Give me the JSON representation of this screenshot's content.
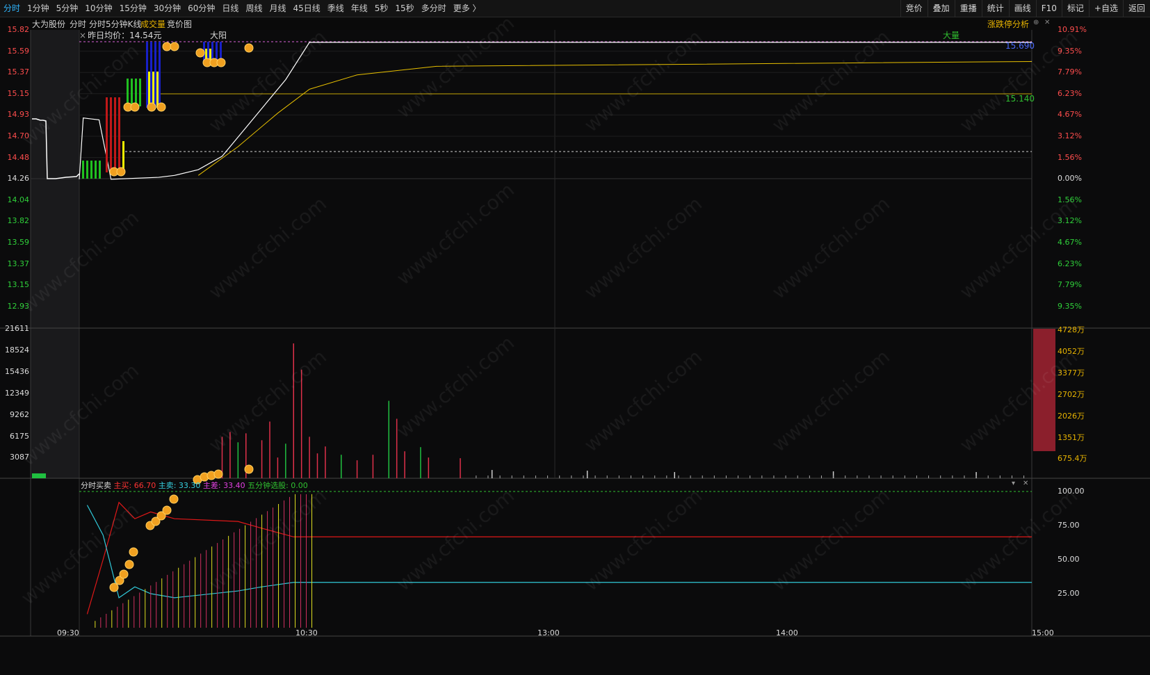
{
  "periods": [
    "分时",
    "1分钟",
    "5分钟",
    "10分钟",
    "15分钟",
    "30分钟",
    "60分钟",
    "日线",
    "周线",
    "月线",
    "45日线",
    "季线",
    "年线",
    "5秒",
    "15秒",
    "多分时",
    "更多 〉"
  ],
  "toolbar_right": [
    "竞价",
    "叠加",
    "重播",
    "统计",
    "画线",
    "F10",
    "标记",
    "+自选",
    "返回"
  ],
  "stock_name": "大为股份",
  "view_tabs": [
    "分时",
    "分时5分钟K线",
    "成交量",
    "竞价图"
  ],
  "analysis_link": "涨跌停分析",
  "prev_avg": "昨日均价：14.54元",
  "price_axis_left": [
    "15.82",
    "15.59",
    "15.37",
    "15.15",
    "14.93",
    "14.70",
    "14.48",
    "14.26",
    "14.04",
    "13.82",
    "13.59",
    "13.37",
    "13.15",
    "12.93"
  ],
  "pct_axis_right": [
    "10.91%",
    "9.35%",
    "7.79%",
    "6.23%",
    "4.67%",
    "3.12%",
    "1.56%",
    "0.00%",
    "1.56%",
    "3.12%",
    "4.67%",
    "6.23%",
    "7.79%",
    "9.35%"
  ],
  "volume_axis_left": [
    "21611",
    "18524",
    "15436",
    "12349",
    "9262",
    "6175",
    "3087"
  ],
  "volume_axis_right": [
    "4728万",
    "4052万",
    "3377万",
    "2702万",
    "2026万",
    "1351万",
    "675.4万"
  ],
  "indicator_axis_right": [
    "100.00",
    "75.00",
    "50.00",
    "25.00"
  ],
  "time_axis": [
    "09:30",
    "10:30",
    "13:00",
    "14:00",
    "15:00"
  ],
  "annotations": {
    "dayang": "大阳",
    "daliang": "大量",
    "limit_price": "15.690",
    "ma_price": "15.140"
  },
  "indicator": {
    "name": "分时买卖",
    "main_buy": "主买: 66.70",
    "main_sell": "主卖: 33.30",
    "main_diff": "主差: 33.40",
    "pick": "五分钟选股: 0.00"
  },
  "watermark": "www.cfchi.com",
  "chart_data": {
    "type": "line",
    "prev_close": 14.26,
    "price_range": [
      12.93,
      15.82
    ],
    "price_series": [
      {
        "t": 0,
        "p": 14.26
      },
      {
        "t": 1,
        "p": 14.9
      },
      {
        "t": 5,
        "p": 14.88
      },
      {
        "t": 8,
        "p": 14.26
      },
      {
        "t": 20,
        "p": 14.28
      },
      {
        "t": 24,
        "p": 14.3
      },
      {
        "t": 30,
        "p": 14.36
      },
      {
        "t": 36,
        "p": 14.5
      },
      {
        "t": 44,
        "p": 14.9
      },
      {
        "t": 52,
        "p": 15.3
      },
      {
        "t": 58,
        "p": 15.69
      },
      {
        "t": 240,
        "p": 15.69
      }
    ],
    "avg_series": [
      {
        "t": 30,
        "p": 14.3
      },
      {
        "t": 40,
        "p": 14.6
      },
      {
        "t": 50,
        "p": 14.95
      },
      {
        "t": 58,
        "p": 15.2
      },
      {
        "t": 70,
        "p": 15.35
      },
      {
        "t": 90,
        "p": 15.44
      },
      {
        "t": 240,
        "p": 15.49
      }
    ],
    "volume_max": 21611,
    "volume_bars": [
      {
        "t": 36,
        "v": 6000,
        "c": "r"
      },
      {
        "t": 38,
        "v": 6700,
        "c": "r"
      },
      {
        "t": 40,
        "v": 5200,
        "c": "g"
      },
      {
        "t": 42,
        "v": 6500,
        "c": "r"
      },
      {
        "t": 46,
        "v": 5500,
        "c": "r"
      },
      {
        "t": 48,
        "v": 8200,
        "c": "r"
      },
      {
        "t": 50,
        "v": 3000,
        "c": "r"
      },
      {
        "t": 52,
        "v": 5000,
        "c": "g"
      },
      {
        "t": 54,
        "v": 19500,
        "c": "r"
      },
      {
        "t": 56,
        "v": 15700,
        "c": "r"
      },
      {
        "t": 58,
        "v": 6000,
        "c": "r"
      },
      {
        "t": 60,
        "v": 3600,
        "c": "r"
      },
      {
        "t": 62,
        "v": 4600,
        "c": "r"
      },
      {
        "t": 66,
        "v": 3400,
        "c": "g"
      },
      {
        "t": 70,
        "v": 2600,
        "c": "r"
      },
      {
        "t": 74,
        "v": 3400,
        "c": "r"
      },
      {
        "t": 78,
        "v": 11200,
        "c": "g"
      },
      {
        "t": 80,
        "v": 8600,
        "c": "r"
      },
      {
        "t": 82,
        "v": 3900,
        "c": "r"
      },
      {
        "t": 86,
        "v": 4500,
        "c": "g"
      },
      {
        "t": 88,
        "v": 3000,
        "c": "r"
      },
      {
        "t": 96,
        "v": 2900,
        "c": "r"
      },
      {
        "t": 104,
        "v": 1200,
        "c": "w"
      },
      {
        "t": 128,
        "v": 1100,
        "c": "w"
      },
      {
        "t": 150,
        "v": 900,
        "c": "w"
      },
      {
        "t": 190,
        "v": 1000,
        "c": "w"
      },
      {
        "t": 226,
        "v": 900,
        "c": "w"
      }
    ],
    "indicator_range": [
      0,
      100
    ],
    "buy_series": [
      {
        "t": 2,
        "v": 10
      },
      {
        "t": 6,
        "v": 50
      },
      {
        "t": 10,
        "v": 92
      },
      {
        "t": 14,
        "v": 80
      },
      {
        "t": 18,
        "v": 85
      },
      {
        "t": 24,
        "v": 80
      },
      {
        "t": 40,
        "v": 78
      },
      {
        "t": 46,
        "v": 73
      },
      {
        "t": 54,
        "v": 66.7
      },
      {
        "t": 240,
        "v": 66.7
      }
    ],
    "sell_series": [
      {
        "t": 2,
        "v": 90
      },
      {
        "t": 6,
        "v": 68
      },
      {
        "t": 10,
        "v": 22
      },
      {
        "t": 14,
        "v": 30
      },
      {
        "t": 18,
        "v": 25
      },
      {
        "t": 24,
        "v": 22
      },
      {
        "t": 40,
        "v": 27
      },
      {
        "t": 46,
        "v": 30
      },
      {
        "t": 54,
        "v": 33.3
      },
      {
        "t": 240,
        "v": 33.3
      }
    ]
  }
}
